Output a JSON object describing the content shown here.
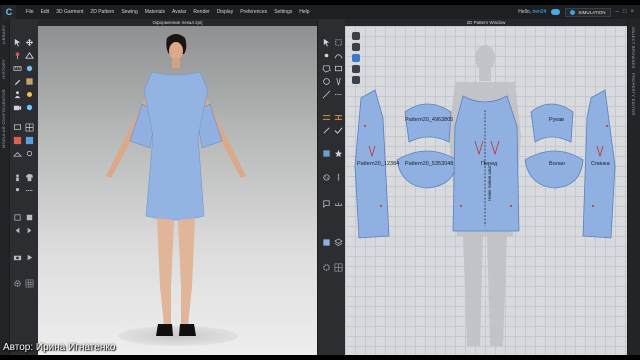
{
  "app": {
    "logo": "C",
    "menu": [
      "File",
      "Edit",
      "3D Garment",
      "2D Pattern",
      "Sewing",
      "Materials",
      "Avatar",
      "Render",
      "Display",
      "Preferences",
      "Settings",
      "Help"
    ],
    "user_greeting": "Hello,",
    "user_name": "iren24",
    "mode": "SIMULATION",
    "window_controls": [
      "–",
      "□",
      "×"
    ]
  },
  "left_strip": [
    "LIBRARY",
    "HISTORY",
    "MODULAR CONFIGURATOR"
  ],
  "right_strip": [
    "OBJECT BROWSER",
    "PROPERTY EDITOR"
  ],
  "viewport3d": {
    "title": "Оформление лекал.zprj"
  },
  "viewport2d": {
    "title": "2D Pattern Window",
    "pieces": [
      {
        "label": "Pattern20_4963805"
      },
      {
        "label": "Рукав"
      },
      {
        "label": "Pattern20_12384"
      },
      {
        "label": "Pattern20_5353048"
      },
      {
        "label": "Перед"
      },
      {
        "label": "Волан"
      },
      {
        "label": "Спинка"
      }
    ],
    "grainline_label": "Ниже линия шва"
  },
  "caption": "Автор: Ирина Игнатенко",
  "colors": {
    "fabric": "#8fb0e0",
    "fabric_stroke": "#5a7fbf",
    "accent": "#4db3ff"
  }
}
